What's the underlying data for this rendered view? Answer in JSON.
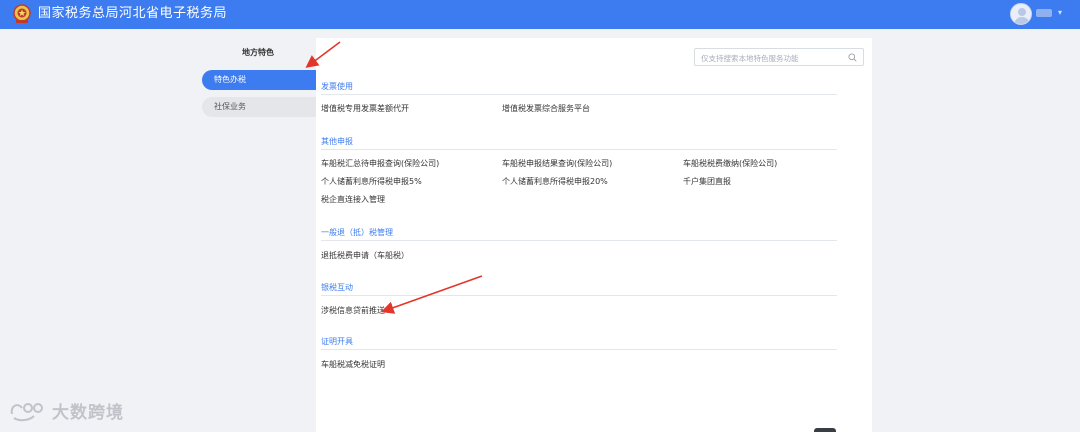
{
  "header": {
    "site_title": "国家税务总局河北省电子税务局",
    "logo_icon": "tax-emblem-icon",
    "avatar_icon": "user-avatar-icon",
    "brand_color": "#3d7cf0"
  },
  "sidebar": {
    "title": "地方特色",
    "items": [
      {
        "label": "特色办税",
        "active": true
      },
      {
        "label": "社保业务",
        "active": false
      }
    ]
  },
  "search": {
    "placeholder": "仅支持搜索本地特色服务功能",
    "icon": "search-icon"
  },
  "sections": [
    {
      "title": "发票使用",
      "items": [
        "增值税专用发票差额代开",
        "增值税发票综合服务平台"
      ]
    },
    {
      "title": "其他申报",
      "items": [
        "车船税汇总待申报查询(保险公司)",
        "车船税申报结果查询(保险公司)",
        "车船税税费缴纳(保险公司)",
        "个人储蓄利息所得税申报5%",
        "个人储蓄利息所得税申报20%",
        "千户集团直报",
        "税企直连接入管理"
      ]
    },
    {
      "title": "一般退（抵）税管理",
      "items": [
        "退抵税费申请（车船税）"
      ]
    },
    {
      "title": "银税互动",
      "items": [
        "涉税信息贷前推送"
      ]
    },
    {
      "title": "证明开具",
      "items": [
        "车船税减免税证明"
      ]
    }
  ],
  "watermark": {
    "text": "大数跨境",
    "icon": "watermark-logo-icon"
  }
}
